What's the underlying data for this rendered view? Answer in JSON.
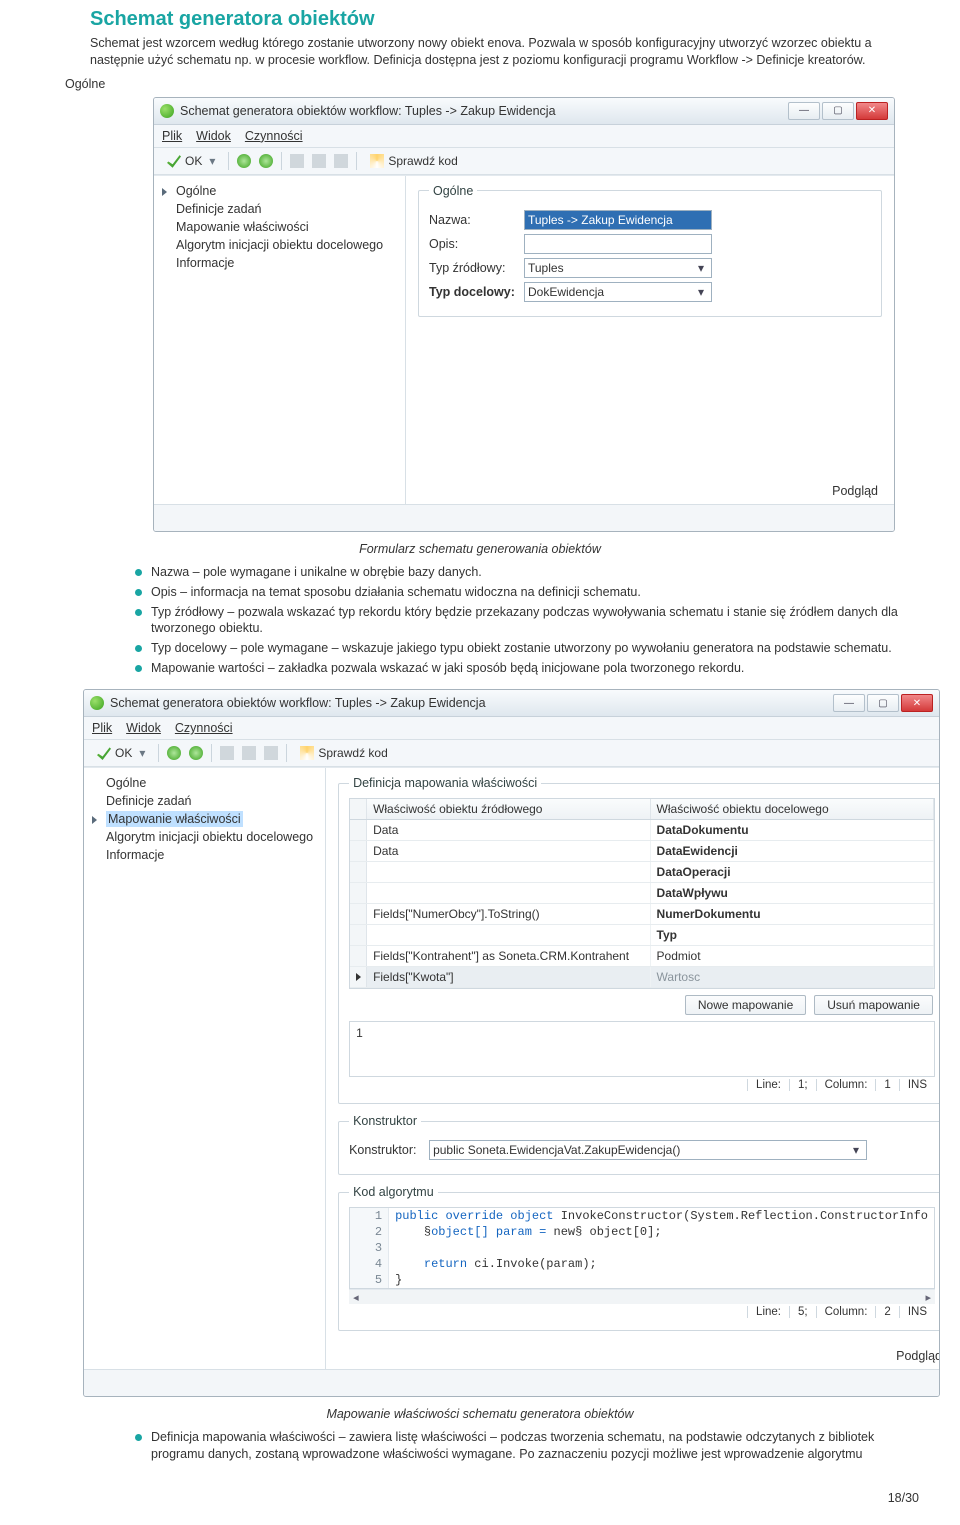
{
  "section_title": "Schemat generatora obiektów",
  "intro": "Schemat jest wzorcem według którego zostanie utworzony nowy obiekt enova. Pozwala w sposób konfiguracyjny utworzyć wzorzec obiektu a następnie użyć schematu np. w procesie workflow. Definicja dostępna jest z poziomu konfiguracji programu Workflow -> Definicje kreatorów.",
  "label_general": "Ogólne",
  "dialog1": {
    "title": "Schemat generatora obiektów workflow: Tuples -> Zakup Ewidencja",
    "menu": {
      "file": "Plik",
      "view": "Widok",
      "actions": "Czynności"
    },
    "toolbar": {
      "ok": "OK",
      "check_code": "Sprawdź kod"
    },
    "sidebar": [
      "Ogólne",
      "Definicje zadań",
      "Mapowanie właściwości",
      "Algorytm inicjacji obiektu docelowego",
      "Informacje"
    ],
    "fieldset_legend": "Ogólne",
    "fields": {
      "name_label": "Nazwa:",
      "name_value": "Tuples -> Zakup Ewidencja",
      "desc_label": "Opis:",
      "desc_value": "",
      "src_label": "Typ źródłowy:",
      "src_value": "Tuples",
      "dst_label": "Typ docelowy:",
      "dst_value": "DokEwidencja"
    },
    "preview": "Podgląd"
  },
  "caption1": "Formularz schematu generowania obiektów",
  "bullets1": [
    "Nazwa – pole wymagane i unikalne w obrębie bazy danych.",
    "Opis – informacja na temat sposobu działania schematu widoczna na definicji schematu.",
    "Typ źródłowy – pozwala wskazać typ rekordu który będzie przekazany podczas wywoływania schematu i stanie się źródłem danych dla tworzonego obiektu.",
    "Typ docelowy – pole wymagane – wskazuje jakiego typu obiekt zostanie utworzony po wywołaniu generatora na podstawie schematu.",
    "Mapowanie wartości – zakładka pozwala wskazać w jaki sposób będą inicjowane pola tworzonego rekordu."
  ],
  "dialog2": {
    "title": "Schemat generatora obiektów workflow: Tuples -> Zakup Ewidencja",
    "menu": {
      "file": "Plik",
      "view": "Widok",
      "actions": "Czynności"
    },
    "toolbar": {
      "ok": "OK",
      "check_code": "Sprawdź kod"
    },
    "sidebar_sel_index": 2,
    "sidebar": [
      "Ogólne",
      "Definicje zadań",
      "Mapowanie właściwości",
      "Algorytm inicjacji obiektu docelowego",
      "Informacje"
    ],
    "mapping_legend": "Definicja mapowania właściwości",
    "columns": {
      "src": "Właściwość obiektu źródłowego",
      "dst": "Właściwość obiektu docelowego"
    },
    "rows": [
      {
        "src": "Data",
        "dst": "DataDokumentu",
        "bold": true
      },
      {
        "src": "Data",
        "dst": "DataEwidencji",
        "bold": true
      },
      {
        "src": "",
        "dst": "DataOperacji",
        "bold": true
      },
      {
        "src": "",
        "dst": "DataWpływu",
        "bold": true
      },
      {
        "src": "Fields[\"NumerObcy\"].ToString()",
        "dst": "NumerDokumentu",
        "bold": true
      },
      {
        "src": "",
        "dst": "Typ",
        "bold": true
      },
      {
        "src": "Fields[\"Kontrahent\"] as Soneta.CRM.Kontrahent",
        "dst": "Podmiot",
        "bold": false
      },
      {
        "src": "Fields[\"Kwota\"]",
        "dst": "Wartosc",
        "bold": false,
        "sel": true
      }
    ],
    "buttons": {
      "new": "Nowe mapowanie",
      "del": "Usuń mapowanie"
    },
    "editor_value": "1",
    "status1": {
      "line": "Line:",
      "lv": "1;",
      "col": "Column:",
      "cv": "1",
      "ins": "INS"
    },
    "konstruktor_legend": "Konstruktor",
    "konstruktor_label": "Konstruktor:",
    "konstruktor_value": "public Soneta.EwidencjaVat.ZakupEwidencja()",
    "kod_legend": "Kod algorytmu",
    "code_lines": [
      {
        "n": "1",
        "t": "public override object InvokeConstructor(System.Reflection.ConstructorInfo",
        "kw": [
          "public",
          "override",
          "object"
        ]
      },
      {
        "n": "2",
        "t": "    object[] param = new object[0];",
        "kw": [
          "object",
          "new",
          "object"
        ]
      },
      {
        "n": "3",
        "t": ""
      },
      {
        "n": "4",
        "t": "    return ci.Invoke(param);",
        "kw": [
          "return"
        ]
      },
      {
        "n": "5",
        "t": "}"
      }
    ],
    "status2": {
      "line": "Line:",
      "lv": "5;",
      "col": "Column:",
      "cv": "2",
      "ins": "INS"
    },
    "preview": "Podgląd"
  },
  "caption2": "Mapowanie właściwości schematu generatora obiektów",
  "bullets2": [
    "Definicja mapowania właściwości – zawiera listę właściwości – podczas tworzenia schematu, na podstawie odczytanych z bibliotek programu danych, zostaną wprowadzone właściwości wymagane. Po zaznaczeniu pozycji możliwe jest wprowadzenie algorytmu"
  ],
  "page_number": "18/30"
}
